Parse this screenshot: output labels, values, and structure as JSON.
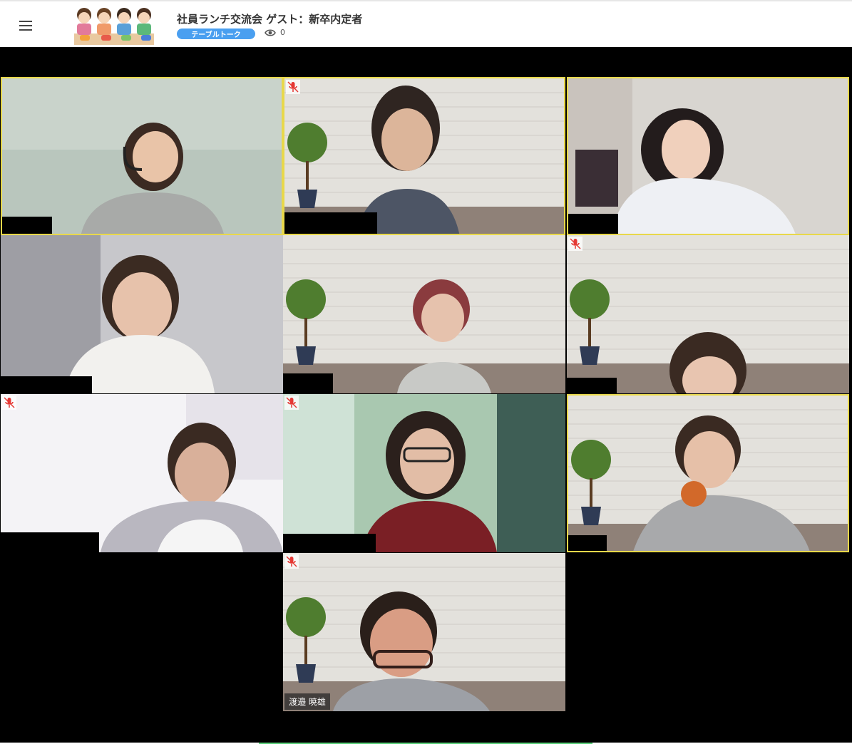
{
  "header": {
    "title": "社員ランチ交流会 ゲスト：新卒内定者",
    "tag_label": "テーブルトーク",
    "view_count": "0",
    "icons": {
      "menu": "hamburger-menu-icon",
      "views": "eye-icon",
      "logo": "lunch-illustration"
    }
  },
  "tiles": [
    {
      "id": "tile-1",
      "active": true,
      "muted": false,
      "name": "",
      "background": "room"
    },
    {
      "id": "tile-2",
      "active": true,
      "muted": true,
      "name": "",
      "background": "brick"
    },
    {
      "id": "tile-3",
      "active": true,
      "muted": false,
      "name": "",
      "background": "room"
    },
    {
      "id": "tile-4",
      "active": false,
      "muted": false,
      "name": "",
      "background": "blur"
    },
    {
      "id": "tile-5",
      "active": false,
      "muted": false,
      "name": "",
      "background": "brick"
    },
    {
      "id": "tile-6",
      "active": false,
      "muted": true,
      "name": "",
      "background": "brick"
    },
    {
      "id": "tile-7",
      "active": false,
      "muted": true,
      "name": "",
      "background": "white"
    },
    {
      "id": "tile-8",
      "active": false,
      "muted": true,
      "name": "",
      "background": "green-blur"
    },
    {
      "id": "tile-9",
      "active": true,
      "muted": false,
      "name": "",
      "background": "brick"
    },
    {
      "id": "tile-10",
      "active": false,
      "muted": true,
      "name": "渡邉 暁雄",
      "background": "brick"
    }
  ],
  "colors": {
    "accent": "#4a9ff0",
    "active_border": "#e8d84a",
    "muted_icon": "#e53935",
    "stage": "#000000"
  }
}
